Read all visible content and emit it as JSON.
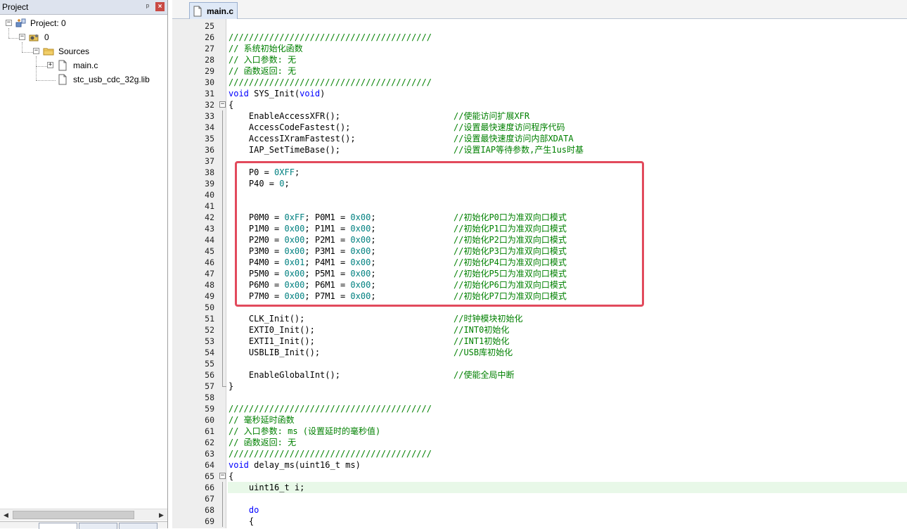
{
  "project_panel": {
    "title": "Project",
    "pin_glyph": "ᵖ",
    "close_glyph": "×",
    "tree": {
      "project": "Project: 0",
      "target": "0",
      "group": "Sources",
      "files": [
        "main.c",
        "stc_usb_cdc_32g.lib"
      ]
    }
  },
  "editor": {
    "tab": "main.c",
    "lines": [
      {
        "n": "25",
        "code": "",
        "comment": ""
      },
      {
        "n": "26",
        "code": "",
        "comment": "",
        "line_comment": "////////////////////////////////////////"
      },
      {
        "n": "27",
        "code": "",
        "comment": "",
        "line_comment": "// 系统初始化函数"
      },
      {
        "n": "28",
        "code": "",
        "comment": "",
        "line_comment": "// 入口参数: 无"
      },
      {
        "n": "29",
        "code": "",
        "comment": "",
        "line_comment": "// 函数返回: 无"
      },
      {
        "n": "30",
        "code": "",
        "comment": "",
        "line_comment": "////////////////////////////////////////"
      },
      {
        "n": "31",
        "kw": "void",
        "code": " SYS_Init(",
        "kw2": "void",
        "code2": ")",
        "comment": ""
      },
      {
        "n": "32",
        "code": "{",
        "comment": ""
      },
      {
        "n": "33",
        "code": "    EnableAccessXFR();",
        "comment": "//使能访问扩展XFR"
      },
      {
        "n": "34",
        "code": "    AccessCodeFastest();",
        "comment": "//设置最快速度访问程序代码"
      },
      {
        "n": "35",
        "code": "    AccessIXramFastest();",
        "comment": "//设置最快速度访问内部XDATA"
      },
      {
        "n": "36",
        "code": "    IAP_SetTimeBase();",
        "comment": "//设置IAP等待参数,产生1us时基"
      },
      {
        "n": "37",
        "code": "",
        "comment": ""
      },
      {
        "n": "38",
        "code": "    P0 = ",
        "num": "0XFF",
        "tail": ";",
        "comment": ""
      },
      {
        "n": "39",
        "code": "    P40 = ",
        "num": "0",
        "tail": ";",
        "comment": ""
      },
      {
        "n": "40",
        "code": "",
        "comment": ""
      },
      {
        "n": "41",
        "code": "",
        "comment": ""
      },
      {
        "n": "42",
        "code": "    P0M0 = ",
        "num": "0xFF",
        "mid": "; P0M1 = ",
        "num2": "0x00",
        "tail": ";",
        "comment": "//初始化P0口为准双向口模式"
      },
      {
        "n": "43",
        "code": "    P1M0 = ",
        "num": "0x00",
        "mid": "; P1M1 = ",
        "num2": "0x00",
        "tail": ";",
        "comment": "//初始化P1口为准双向口模式"
      },
      {
        "n": "44",
        "code": "    P2M0 = ",
        "num": "0x00",
        "mid": "; P2M1 = ",
        "num2": "0x00",
        "tail": ";",
        "comment": "//初始化P2口为准双向口模式"
      },
      {
        "n": "45",
        "code": "    P3M0 = ",
        "num": "0x00",
        "mid": "; P3M1 = ",
        "num2": "0x00",
        "tail": ";",
        "comment": "//初始化P3口为准双向口模式"
      },
      {
        "n": "46",
        "code": "    P4M0 = ",
        "num": "0x01",
        "mid": "; P4M1 = ",
        "num2": "0x00",
        "tail": ";",
        "comment": "//初始化P4口为准双向口模式"
      },
      {
        "n": "47",
        "code": "    P5M0 = ",
        "num": "0x00",
        "mid": "; P5M1 = ",
        "num2": "0x00",
        "tail": ";",
        "comment": "//初始化P5口为准双向口模式"
      },
      {
        "n": "48",
        "code": "    P6M0 = ",
        "num": "0x00",
        "mid": "; P6M1 = ",
        "num2": "0x00",
        "tail": ";",
        "comment": "//初始化P6口为准双向口模式"
      },
      {
        "n": "49",
        "code": "    P7M0 = ",
        "num": "0x00",
        "mid": "; P7M1 = ",
        "num2": "0x00",
        "tail": ";",
        "comment": "//初始化P7口为准双向口模式"
      },
      {
        "n": "50",
        "code": "",
        "comment": ""
      },
      {
        "n": "51",
        "code": "    CLK_Init();",
        "comment": "//时钟模块初始化"
      },
      {
        "n": "52",
        "code": "    EXTI0_Init();",
        "comment": "//INT0初始化"
      },
      {
        "n": "53",
        "code": "    EXTI1_Init();",
        "comment": "//INT1初始化"
      },
      {
        "n": "54",
        "code": "    USBLIB_Init();",
        "comment": "//USB库初始化"
      },
      {
        "n": "55",
        "code": "",
        "comment": ""
      },
      {
        "n": "56",
        "code": "    EnableGlobalInt();",
        "comment": "//使能全局中断"
      },
      {
        "n": "57",
        "code": "}",
        "comment": ""
      },
      {
        "n": "58",
        "code": "",
        "comment": ""
      },
      {
        "n": "59",
        "code": "",
        "comment": "",
        "line_comment": "////////////////////////////////////////"
      },
      {
        "n": "60",
        "code": "",
        "comment": "",
        "line_comment": "// 毫秒延时函数"
      },
      {
        "n": "61",
        "code": "",
        "comment": "",
        "line_comment": "// 入口参数: ms (设置延时的毫秒值)"
      },
      {
        "n": "62",
        "code": "",
        "comment": "",
        "line_comment": "// 函数返回: 无"
      },
      {
        "n": "63",
        "code": "",
        "comment": "",
        "line_comment": "////////////////////////////////////////"
      },
      {
        "n": "64",
        "kw": "void",
        "code": " delay_ms(uint16_t ms)",
        "comment": ""
      },
      {
        "n": "65",
        "code": "{",
        "comment": ""
      },
      {
        "n": "66",
        "code": "    uint16_t i;",
        "comment": ""
      },
      {
        "n": "67",
        "code": "",
        "comment": ""
      },
      {
        "n": "68",
        "code": "    ",
        "kw": "do",
        "comment": ""
      },
      {
        "n": "69",
        "code": "    {",
        "comment": ""
      }
    ]
  },
  "colors": {
    "comment": "#008000",
    "keyword": "#0000ff",
    "number": "#008080",
    "highlight_box": "#e24a5c",
    "current_line": "#e8f8e8"
  }
}
